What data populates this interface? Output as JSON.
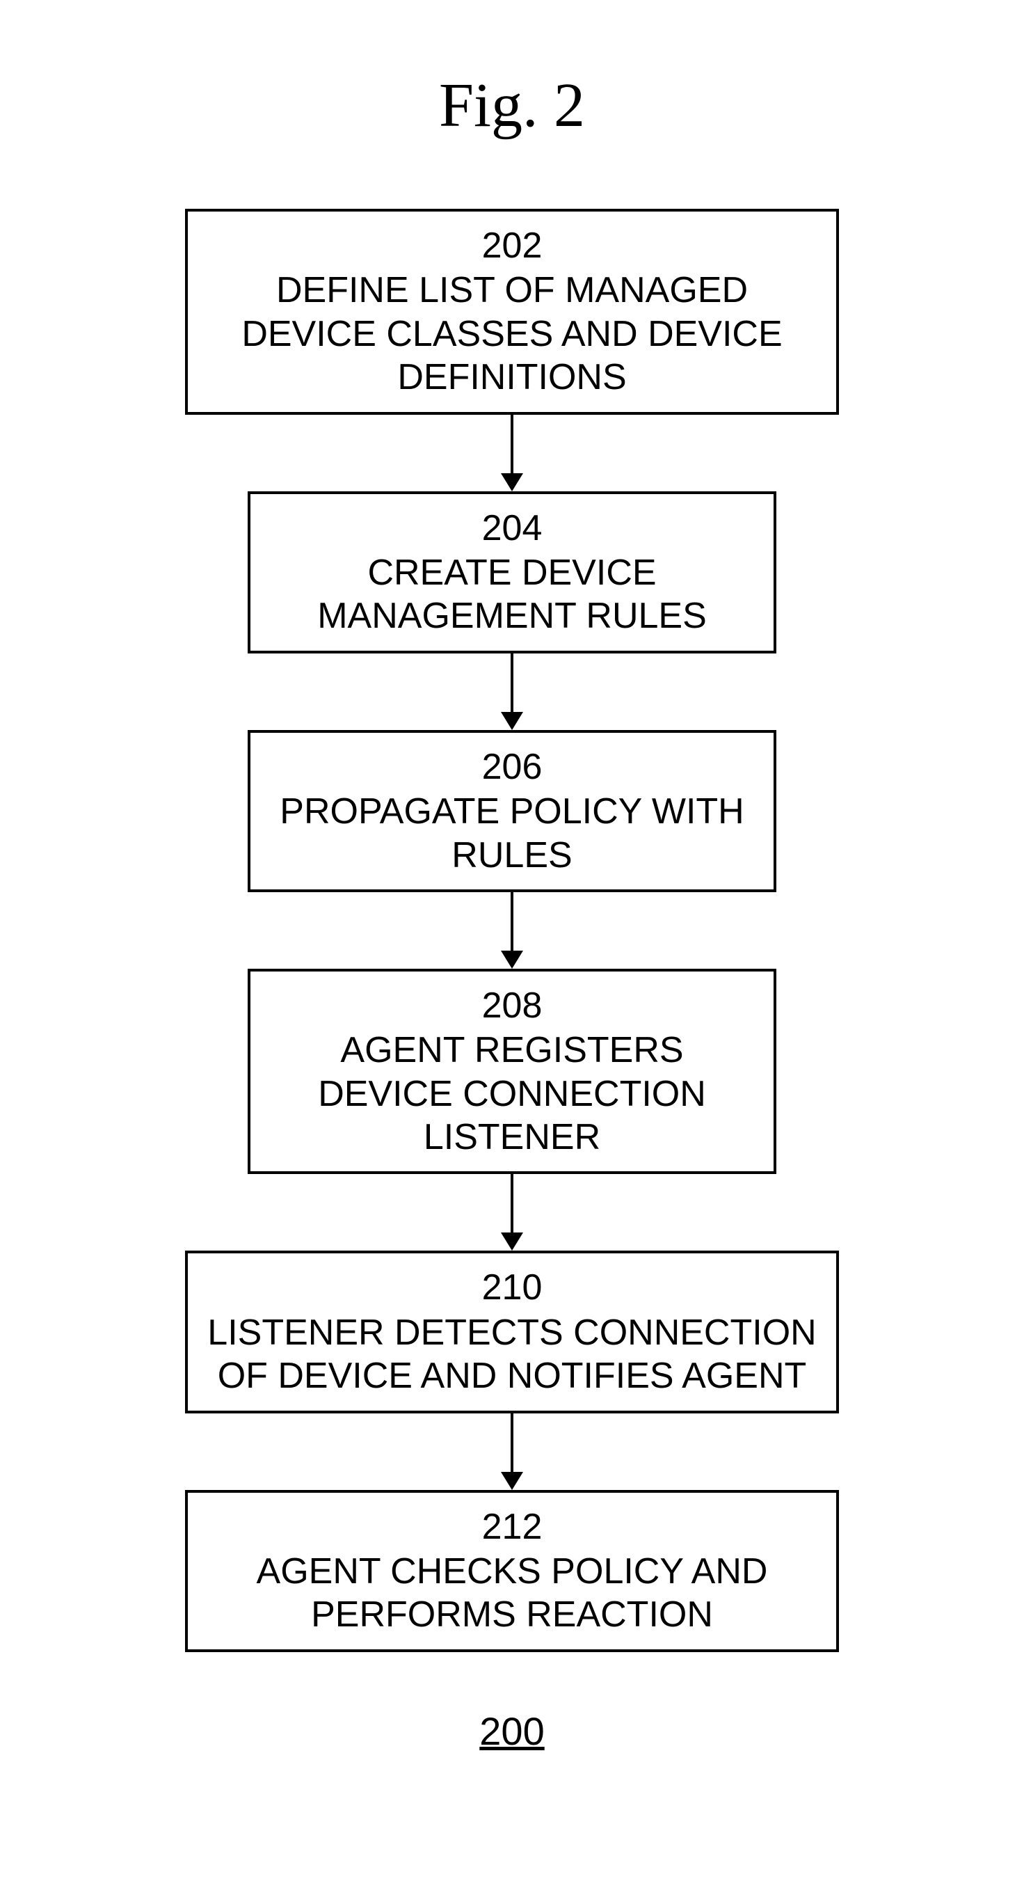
{
  "title": "Fig. 2",
  "figure_number": "200",
  "steps": [
    {
      "num": "202",
      "text": "DEFINE LIST OF MANAGED DEVICE CLASSES AND DEVICE DEFINITIONS"
    },
    {
      "num": "204",
      "text": "CREATE DEVICE MANAGEMENT RULES"
    },
    {
      "num": "206",
      "text": "PROPAGATE POLICY WITH RULES"
    },
    {
      "num": "208",
      "text": "AGENT REGISTERS DEVICE CONNECTION LISTENER"
    },
    {
      "num": "210",
      "text": "LISTENER DETECTS CONNECTION OF DEVICE AND NOTIFIES AGENT"
    },
    {
      "num": "212",
      "text": "AGENT CHECKS POLICY AND PERFORMS REACTION"
    }
  ],
  "chart_data": {
    "type": "flowchart",
    "title": "Fig. 2",
    "nodes": [
      {
        "id": "202",
        "label": "DEFINE LIST OF MANAGED DEVICE CLASSES AND DEVICE DEFINITIONS"
      },
      {
        "id": "204",
        "label": "CREATE DEVICE MANAGEMENT RULES"
      },
      {
        "id": "206",
        "label": "PROPAGATE POLICY WITH RULES"
      },
      {
        "id": "208",
        "label": "AGENT REGISTERS DEVICE CONNECTION LISTENER"
      },
      {
        "id": "210",
        "label": "LISTENER DETECTS CONNECTION OF DEVICE AND NOTIFIES AGENT"
      },
      {
        "id": "212",
        "label": "AGENT CHECKS POLICY AND PERFORMS REACTION"
      }
    ],
    "edges": [
      {
        "from": "202",
        "to": "204"
      },
      {
        "from": "204",
        "to": "206"
      },
      {
        "from": "206",
        "to": "208"
      },
      {
        "from": "208",
        "to": "210"
      },
      {
        "from": "210",
        "to": "212"
      }
    ],
    "figure_number": "200"
  }
}
